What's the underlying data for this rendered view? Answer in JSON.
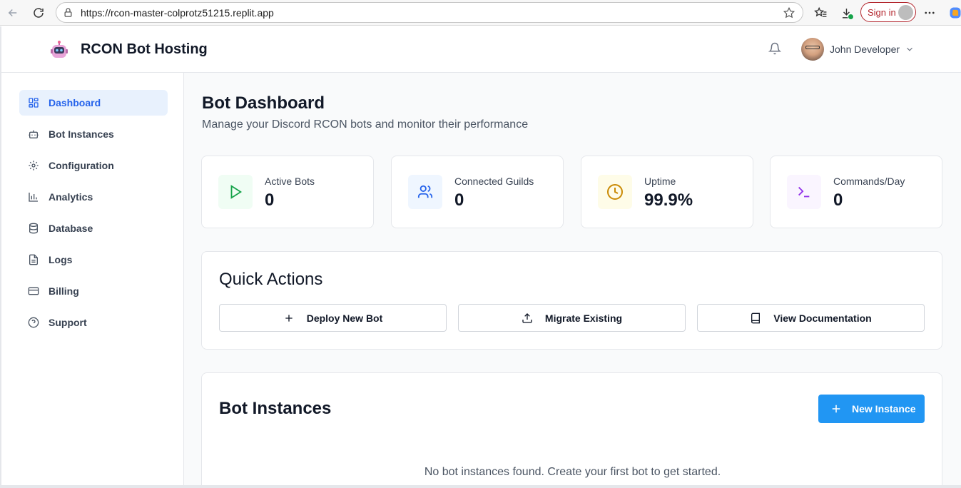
{
  "browser": {
    "url": "https://rcon-master-colprotz51215.replit.app",
    "signin_label": "Sign in"
  },
  "header": {
    "brand": "RCON Bot Hosting",
    "user_name": "John Developer"
  },
  "sidebar": {
    "items": [
      {
        "label": "Dashboard",
        "icon": "layout-grid-icon",
        "active": true
      },
      {
        "label": "Bot Instances",
        "icon": "bot-icon"
      },
      {
        "label": "Configuration",
        "icon": "gear-icon"
      },
      {
        "label": "Analytics",
        "icon": "bar-chart-icon"
      },
      {
        "label": "Database",
        "icon": "database-icon"
      },
      {
        "label": "Logs",
        "icon": "file-text-icon"
      },
      {
        "label": "Billing",
        "icon": "credit-card-icon"
      },
      {
        "label": "Support",
        "icon": "help-circle-icon"
      }
    ]
  },
  "main": {
    "title": "Bot Dashboard",
    "subtitle": "Manage your Discord RCON bots and monitor their performance",
    "stats": [
      {
        "label": "Active Bots",
        "value": "0",
        "icon": "play-icon",
        "color": "#16a34a",
        "bg": "#f0fdf4"
      },
      {
        "label": "Connected Guilds",
        "value": "0",
        "icon": "users-icon",
        "color": "#2563eb",
        "bg": "#eff6ff"
      },
      {
        "label": "Uptime",
        "value": "99.9%",
        "icon": "clock-icon",
        "color": "#ca8a04",
        "bg": "#fefce8"
      },
      {
        "label": "Commands/Day",
        "value": "0",
        "icon": "terminal-icon",
        "color": "#9333ea",
        "bg": "#faf5ff"
      }
    ],
    "quick_actions": {
      "title": "Quick Actions",
      "buttons": [
        {
          "label": "Deploy New Bot",
          "icon": "plus-icon"
        },
        {
          "label": "Migrate Existing",
          "icon": "upload-icon"
        },
        {
          "label": "View Documentation",
          "icon": "book-icon"
        }
      ]
    },
    "bot_instances": {
      "title": "Bot Instances",
      "new_button": "New Instance",
      "empty_message": "No bot instances found. Create your first bot to get started."
    }
  }
}
